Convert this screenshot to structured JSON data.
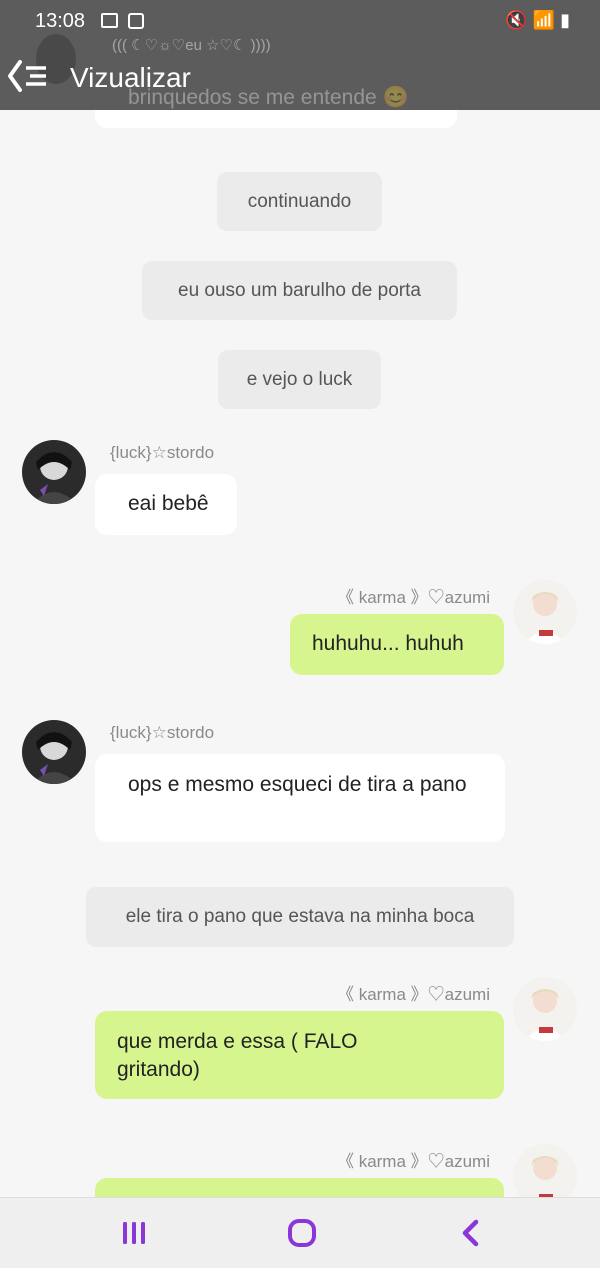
{
  "status_bar": {
    "time": "13:08",
    "icons": "🔇 📶 ▮"
  },
  "header": {
    "title": "Vizualizar",
    "peek_name": "((( ☾♡☼♡eu ☆♡☾ ))))",
    "peek_text": "brinquedos se me entende 😊"
  },
  "messages": {
    "sys1": "continuando",
    "sys2": "eu ouso um barulho de porta",
    "sys3": "e vejo o luck",
    "luck_name_1": "{luck}☆stordo",
    "luck_msg_1": "eai bebê",
    "karma_name_1": "《 karma 》♡azumi",
    "karma_msg_1": "huhuhu... huhuh",
    "luck_name_2": "{luck}☆stordo",
    "luck_msg_2": "ops e mesmo esqueci de tira a pano",
    "sys4": "ele tira o pano que estava na minha boca",
    "karma_name_2": "《 karma 》♡azumi",
    "karma_msg_2": "que merda e essa ( FALO gritando)",
    "karma_name_3": "《 karma 》♡azumi"
  },
  "nav": {
    "recent": "recent-apps",
    "home": "home",
    "back": "back"
  }
}
